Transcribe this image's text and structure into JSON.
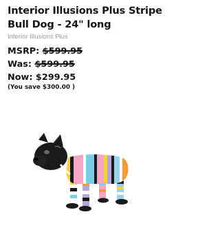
{
  "product": {
    "title": "Interior Illusions Plus Stripe Bull Dog - 24\" long",
    "brand": "Interior Illusions Plus"
  },
  "pricing": {
    "msrp_label": "MSRP:",
    "msrp_value": "$599.95",
    "was_label": "Was:",
    "was_value": "$599.95",
    "now_label": "Now:",
    "now_value": "$299.95",
    "savings_text": "(You save $300.00 )"
  },
  "footer": {
    "mark": "."
  },
  "colors": {
    "text": "#151515",
    "muted": "#9a9a9a",
    "stripes": [
      "#f4a6c4",
      "#7dcde8",
      "#f2d04a",
      "#ffffff",
      "#1a1a1a",
      "#f39a3a",
      "#9ad3ee",
      "#b9a6d8"
    ]
  }
}
